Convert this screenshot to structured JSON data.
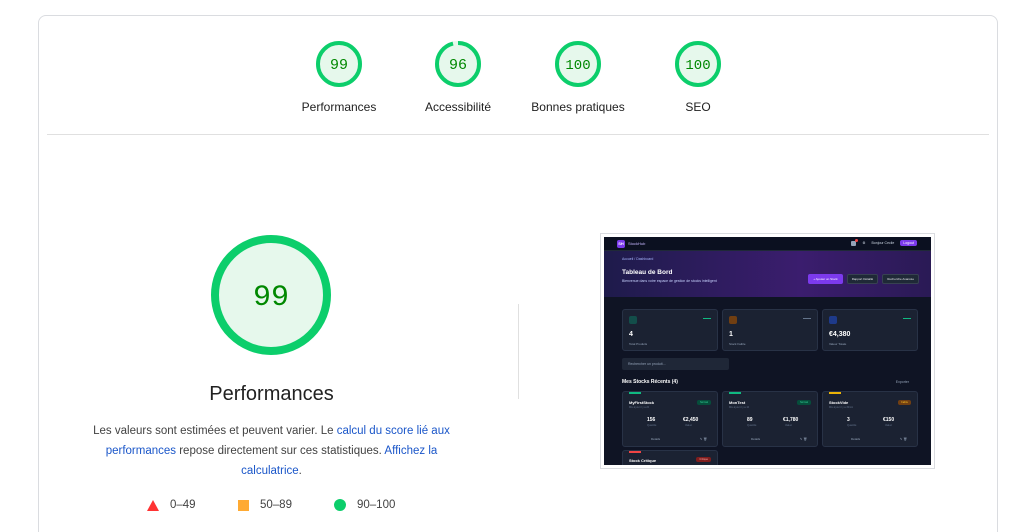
{
  "summary": {
    "gauges": [
      {
        "score": "99",
        "label": "Performances"
      },
      {
        "score": "96",
        "label": "Accessibilité"
      },
      {
        "score": "100",
        "label": "Bonnes pratiques"
      },
      {
        "score": "100",
        "label": "SEO"
      }
    ]
  },
  "detail": {
    "score": "99",
    "title": "Performances",
    "desc_before": "Les valeurs sont estimées et peuvent varier. Le ",
    "desc_link1": "calcul du score lié aux performances",
    "desc_middle": " repose directement sur ces statistiques. ",
    "desc_link2": "Affichez la calculatrice",
    "desc_after": "."
  },
  "legend": {
    "fail": "0–49",
    "average": "50–89",
    "pass": "90–100"
  },
  "colors": {
    "pass": "#0cce6b",
    "pass_text": "#008800",
    "pass_fill": "#e6f8ec",
    "average": "#ffaa33",
    "fail": "#ff3333"
  },
  "thumbnail": {
    "brand": "StockHub",
    "user": "Bonjour Cecile",
    "logout": "Logout",
    "breadcrumb": "Accueil  /  Dashboard",
    "heading": "Tableau de Bord",
    "subheading": "Bienvenue dans votre espace de gestion de stocks intelligent",
    "btn_add": "+ Ajouter un Stock",
    "btn_report": "Rapport Détaillé",
    "btn_search": "Recherche Avancée",
    "stats": [
      {
        "value": "4",
        "label": "Total Produits"
      },
      {
        "value": "1",
        "label": "Stock Faible"
      },
      {
        "value": "€4,380",
        "label": "Valeur Totale"
      }
    ],
    "search_placeholder": "Rechercher un produit...",
    "section_title": "Mes Stocks Récents (4)",
    "export": "Exporter",
    "cards": [
      {
        "name": "MyFirstStock",
        "sub": "Mis à jour il y a 2h",
        "badge": "Normal",
        "qty": "156",
        "qty_label": "Quantité",
        "val": "€2,450",
        "val_label": "Valeur",
        "details": "Détails"
      },
      {
        "name": "MonTest",
        "sub": "Mis à jour il y a 1h",
        "badge": "Normal",
        "qty": "89",
        "qty_label": "Quantité",
        "val": "€1,780",
        "val_label": "Valeur",
        "details": "Détails"
      },
      {
        "name": "StockVide",
        "sub": "Mis à jour il y a 30min",
        "badge": "Faible",
        "qty": "3",
        "qty_label": "Quantité",
        "val": "€150",
        "val_label": "Valeur",
        "details": "Détails"
      }
    ],
    "card4_name": "Stock Critique",
    "card4_badge": "Critique"
  }
}
